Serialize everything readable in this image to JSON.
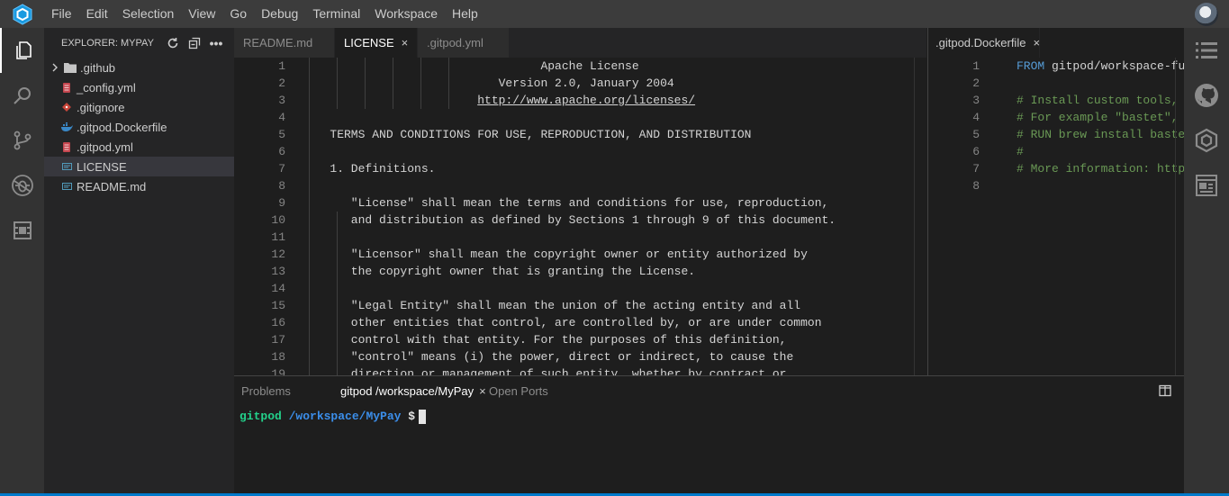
{
  "menubar": {
    "items": [
      "File",
      "Edit",
      "Selection",
      "View",
      "Go",
      "Debug",
      "Terminal",
      "Workspace",
      "Help"
    ]
  },
  "activitybar": {
    "icons": [
      "files-icon",
      "search-icon",
      "source-control-icon",
      "debug-icon",
      "extensions-icon"
    ]
  },
  "explorer": {
    "title": "EXPLORER: MYPAY",
    "items": [
      {
        "label": ".github",
        "type": "folder"
      },
      {
        "label": "_config.yml",
        "type": "yml"
      },
      {
        "label": ".gitignore",
        "type": "git"
      },
      {
        "label": ".gitpod.Dockerfile",
        "type": "docker"
      },
      {
        "label": ".gitpod.yml",
        "type": "yml"
      },
      {
        "label": "LICENSE",
        "type": "text",
        "selected": true
      },
      {
        "label": "README.md",
        "type": "text"
      }
    ]
  },
  "editor1": {
    "tabs": [
      {
        "label": "README.md",
        "active": false
      },
      {
        "label": "LICENSE",
        "active": true,
        "close": "×"
      },
      {
        "label": ".gitpod.yml",
        "active": false
      }
    ],
    "line_numbers": [
      "1",
      "2",
      "3",
      "4",
      "5",
      "6",
      "7",
      "8",
      "9",
      "10",
      "11",
      "12",
      "13",
      "14",
      "15",
      "16",
      "17",
      "18",
      "19"
    ],
    "lines": [
      "                                 Apache License",
      "                           Version 2.0, January 2004",
      "                        http://www.apache.org/licenses/",
      "",
      "   TERMS AND CONDITIONS FOR USE, REPRODUCTION, AND DISTRIBUTION",
      "",
      "   1. Definitions.",
      "",
      "      \"License\" shall mean the terms and conditions for use, reproduction,",
      "      and distribution as defined by Sections 1 through 9 of this document.",
      "",
      "      \"Licensor\" shall mean the copyright owner or entity authorized by",
      "      the copyright owner that is granting the License.",
      "",
      "      \"Legal Entity\" shall mean the union of the acting entity and all",
      "      other entities that control, are controlled by, or are under common",
      "      control with that entity. For the purposes of this definition,",
      "      \"control\" means (i) the power, direct or indirect, to cause the",
      "      direction or management of such entity, whether by contract or"
    ]
  },
  "editor2": {
    "tab": {
      "label": ".gitpod.Dockerfile",
      "close": "×"
    },
    "line_numbers": [
      "1",
      "2",
      "3",
      "4",
      "5",
      "6",
      "7",
      "8"
    ],
    "lines": [
      {
        "kw": "FROM",
        "text": " gitpod/workspace-fu"
      },
      {
        "text": ""
      },
      {
        "comment": "# Install custom tools, "
      },
      {
        "comment": "# For example \"bastet\", "
      },
      {
        "comment": "# RUN brew install baste"
      },
      {
        "comment": "#"
      },
      {
        "comment": "# More information: http"
      },
      {
        "text": ""
      }
    ]
  },
  "panel": {
    "tabs": [
      {
        "label": "Problems"
      },
      {
        "label": "gitpod /workspace/MyPay",
        "active": true,
        "close": "×"
      },
      {
        "label": "Open Ports"
      }
    ],
    "terminal": {
      "user": "gitpod",
      "path": "/workspace/MyPay",
      "prompt": "$"
    }
  },
  "rightbar": {
    "icons": [
      "outline-icon",
      "github-icon",
      "gitpod-cube-icon",
      "preview-icon"
    ]
  },
  "colors": {
    "menubar": "#3c3c3c",
    "activitybar": "#333333",
    "sidebar": "#252526",
    "editor": "#1e1e1e",
    "accent": "#007acc",
    "terminal_user": "#23d18b",
    "terminal_path": "#3b8eea"
  }
}
